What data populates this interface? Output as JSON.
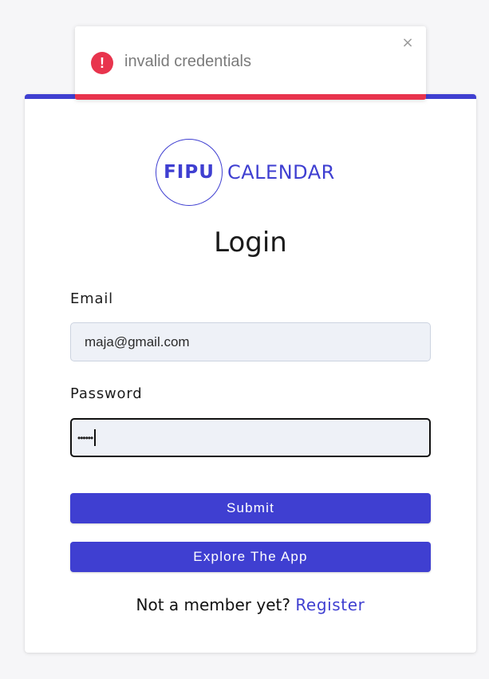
{
  "toast": {
    "icon": "error-icon",
    "icon_glyph": "!",
    "message": "invalid credentials",
    "close_glyph": "×",
    "color": "#e8344d"
  },
  "logo": {
    "circle_text": "FIPU",
    "rest_text": "CALENDAR"
  },
  "form": {
    "title": "Login",
    "email_label": "Email",
    "email_value": "maja@gmail.com",
    "password_label": "Password",
    "password_value": "••••••",
    "submit_label": "Submit",
    "explore_label": "Explore The App",
    "register_prompt": "Not a member yet?",
    "register_link": "Register"
  },
  "colors": {
    "accent": "#3f3fd1",
    "error": "#e8344d"
  }
}
